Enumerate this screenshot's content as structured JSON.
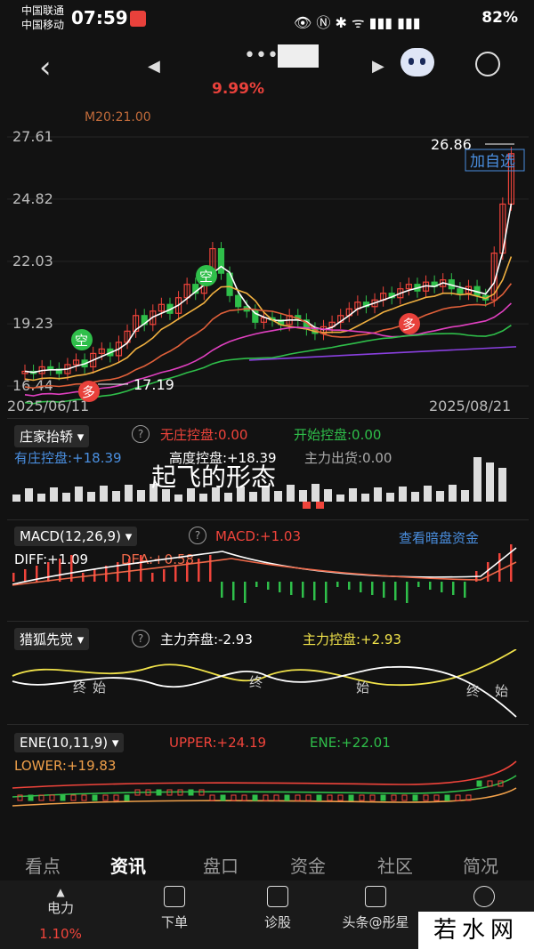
{
  "status_bar": {
    "carrier1": "中国联通",
    "carrier2": "中国移动",
    "time": "07:59",
    "battery": "82%"
  },
  "header": {
    "title": "••••",
    "change_pct": "9.99%"
  },
  "chart_data": [
    {
      "type": "candlestick",
      "title": "",
      "ma_label": "M20:21.00",
      "y_ticks": [
        "27.61",
        "24.82",
        "22.03",
        "19.23",
        "16.44"
      ],
      "ylim": [
        16.44,
        27.61
      ],
      "x_labels": [
        "2025/06/11",
        "2025/08/21"
      ],
      "annotations": [
        "26.86",
        "17.19",
        "加自选",
        "空",
        "空",
        "多",
        "多"
      ],
      "closes": [
        17.1,
        17.0,
        17.3,
        17.2,
        17.0,
        17.4,
        17.6,
        17.3,
        17.9,
        18.1,
        17.8,
        18.4,
        18.9,
        19.6,
        19.2,
        19.8,
        20.1,
        19.7,
        20.4,
        21.0,
        20.6,
        21.3,
        22.6,
        21.5,
        20.5,
        20.0,
        19.8,
        19.3,
        19.5,
        19.4,
        19.2,
        19.6,
        19.4,
        19.0,
        18.8,
        19.1,
        19.3,
        19.6,
        19.9,
        20.2,
        20.0,
        20.3,
        20.6,
        20.4,
        20.8,
        21.0,
        20.7,
        21.1,
        20.9,
        21.2,
        20.8,
        20.6,
        20.9,
        20.5,
        20.3,
        22.4,
        24.6,
        26.86
      ]
    },
    {
      "type": "bar",
      "indicator": "庄家抬轿",
      "labels": [
        "无庄控盘:0.00",
        "开始控盘:0.00",
        "有庄控盘:+18.39",
        "高度控盘:+18.39",
        "主力出货:0.00"
      ]
    },
    {
      "type": "bar",
      "indicator": "MACD(12,26,9)",
      "labels": [
        "MACD:+1.03",
        "DIFF:+1.09",
        "DEA:+0.58"
      ],
      "link": "查看暗盘资金"
    },
    {
      "type": "line",
      "indicator": "猎狐先觉",
      "labels": [
        "主力弃盘:-2.93",
        "主力控盘:+2.93"
      ],
      "markers": [
        "终",
        "始",
        "终",
        "始",
        "终",
        "始"
      ]
    },
    {
      "type": "line",
      "indicator": "ENE(10,11,9)",
      "labels": [
        "UPPER:+24.19",
        "ENE:+22.01",
        "LOWER:+19.83"
      ]
    }
  ],
  "overlay_text": "起飞的形态",
  "tabs": [
    "看点",
    "资讯",
    "盘口",
    "资金",
    "社区",
    "简况"
  ],
  "bottom_nav": {
    "item1": "电力",
    "item1_value": "1.10%",
    "item2": "下单",
    "item3": "诊股",
    "item4": "头条@彤星",
    "item5": "更多"
  },
  "watermark": "若水网",
  "colors": {
    "up": "#f0443b",
    "down": "#2fbf4a",
    "bg": "#121212"
  }
}
